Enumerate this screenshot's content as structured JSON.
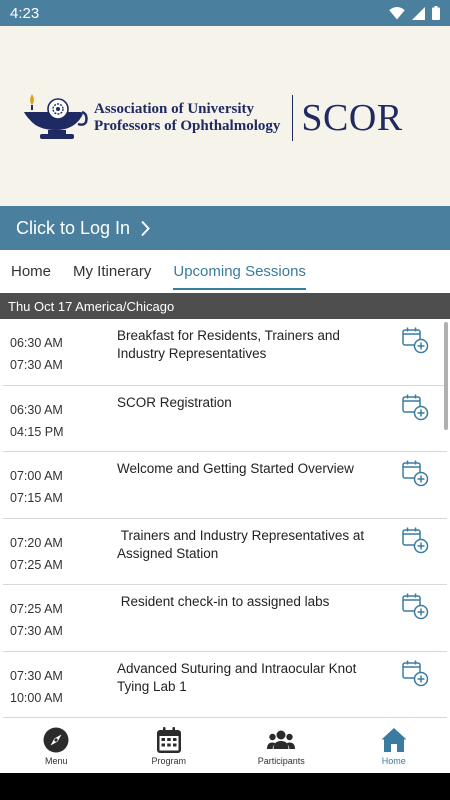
{
  "status_bar": {
    "time": "4:23"
  },
  "banner": {
    "org_line1": "Association of University",
    "org_line2": "Professors of Ophthalmology",
    "brand": "SCOR"
  },
  "login": {
    "label": "Click to Log In"
  },
  "tabs": [
    {
      "label": "Home",
      "active": false
    },
    {
      "label": "My Itinerary",
      "active": false
    },
    {
      "label": "Upcoming Sessions",
      "active": true
    }
  ],
  "date_header": "Thu Oct 17 America/Chicago",
  "sessions": [
    {
      "start": "06:30 AM",
      "end": "07:30 AM",
      "title": "Breakfast for Residents, Trainers and Industry Representatives"
    },
    {
      "start": "06:30 AM",
      "end": "04:15 PM",
      "title": "SCOR Registration"
    },
    {
      "start": "07:00 AM",
      "end": "07:15 AM",
      "title": "Welcome and Getting Started Overview"
    },
    {
      "start": "07:20 AM",
      "end": "07:25 AM",
      "title": " Trainers and Industry Representatives at Assigned Station"
    },
    {
      "start": "07:25 AM",
      "end": "07:30 AM",
      "title": " Resident check-in to assigned labs"
    },
    {
      "start": "07:30 AM",
      "end": "10:00 AM",
      "title": "Advanced Suturing and Intraocular Knot Tying Lab 1"
    }
  ],
  "bottom_nav": [
    {
      "label": "Menu",
      "icon": "compass-icon",
      "active": false
    },
    {
      "label": "Program",
      "icon": "calendar-icon",
      "active": false
    },
    {
      "label": "Participants",
      "icon": "people-icon",
      "active": false
    },
    {
      "label": "Home",
      "icon": "home-icon",
      "active": true
    }
  ],
  "colors": {
    "accent": "#4a7f9d",
    "tab_active": "#3a7ba0",
    "banner_bg": "#f6f3ea",
    "logo_navy": "#1f2a63",
    "date_header_bg": "#4e4e4e"
  }
}
